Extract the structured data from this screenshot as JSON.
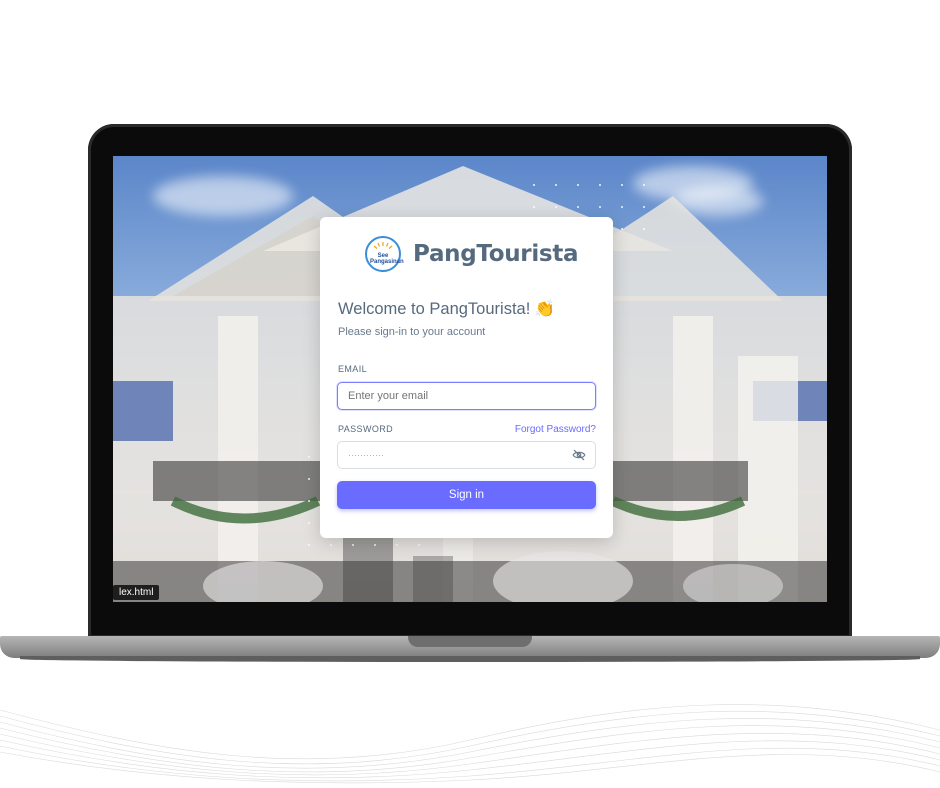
{
  "brand": {
    "name": "PangTourista",
    "logo_text": "See Pangasinan"
  },
  "login": {
    "welcome": "Welcome to PangTourista! 👏",
    "subtitle": "Please sign-in to your account",
    "email_label": "EMAIL",
    "email_placeholder": "Enter your email",
    "password_label": "PASSWORD",
    "password_masked": "············",
    "forgot_label": "Forgot Password?",
    "signin_label": "Sign in"
  },
  "browser": {
    "tab_label": "lex.html"
  },
  "colors": {
    "accent": "#696cff",
    "heading": "#566a7f",
    "muted": "#697a8d"
  },
  "icons": {
    "password_toggle": "eye-off-icon",
    "logo": "sun-logo-icon"
  }
}
